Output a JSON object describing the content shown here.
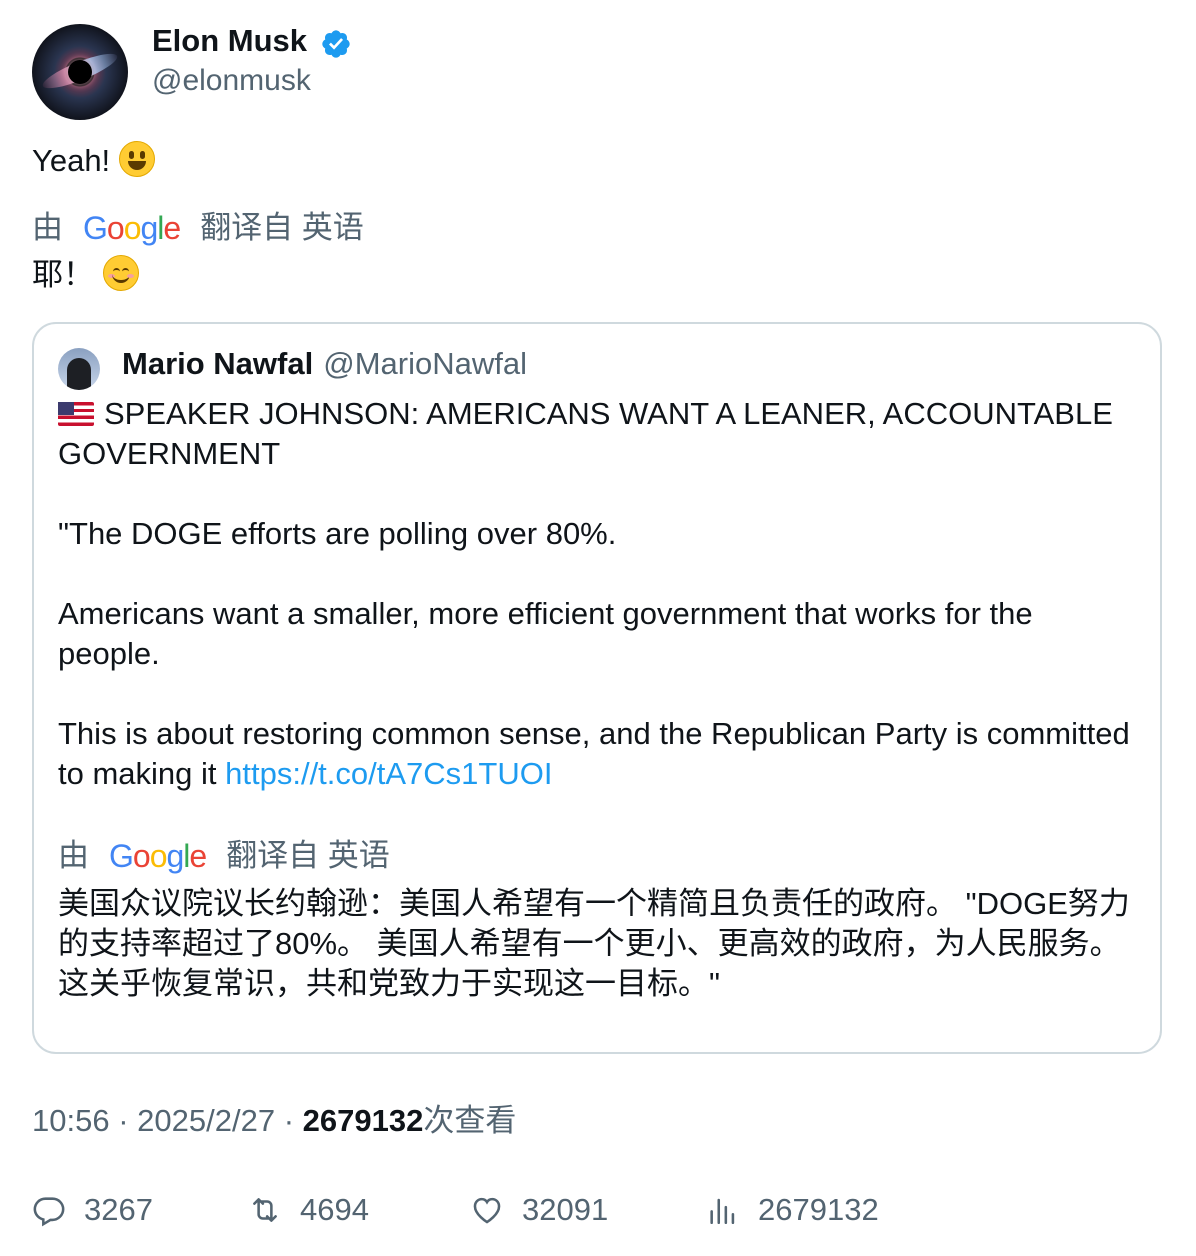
{
  "author": {
    "name": "Elon Musk",
    "handle": "@elonmusk",
    "verified": true,
    "verified_color": "#1d9bf0"
  },
  "tweet": {
    "text": "Yeah!",
    "emoji": "grinning-face",
    "translation": {
      "prefix": "由",
      "provider": "Google",
      "suffix": "翻译自 英语",
      "text": "耶！",
      "emoji": "smiling-face"
    }
  },
  "quoted": {
    "name": "Mario Nawfal",
    "handle": "@MarioNawfal",
    "flag": "us-flag",
    "headline": "SPEAKER JOHNSON: AMERICANS WANT A LEANER, ACCOUNTABLE GOVERNMENT",
    "para1": "\"The DOGE efforts are polling over 80%.",
    "para2": "Americans want a smaller, more efficient government that works for the people.",
    "para3": "This is about restoring common sense, and the Republican Party is committed to making it",
    "link": "https://t.co/tA7Cs1TUOI",
    "translation": {
      "prefix": "由",
      "provider": "Google",
      "suffix": "翻译自 英语",
      "text": "美国众议院议长约翰逊：美国人希望有一个精简且负责任的政府。 \"DOGE努力的支持率超过了80%。 美国人希望有一个更小、更高效的政府，为人民服务。 这关乎恢复常识，共和党致力于实现这一目标。\""
    }
  },
  "meta": {
    "time": "10:56",
    "sep": "·",
    "date": "2025/2/27",
    "views": "2679132",
    "views_label": "次查看"
  },
  "actions": {
    "replies": "3267",
    "retweets": "4694",
    "likes": "32091",
    "views": "2679132"
  },
  "colors": {
    "link": "#1d9bf0",
    "secondary_text": "#536471",
    "border": "#cfd9de"
  }
}
